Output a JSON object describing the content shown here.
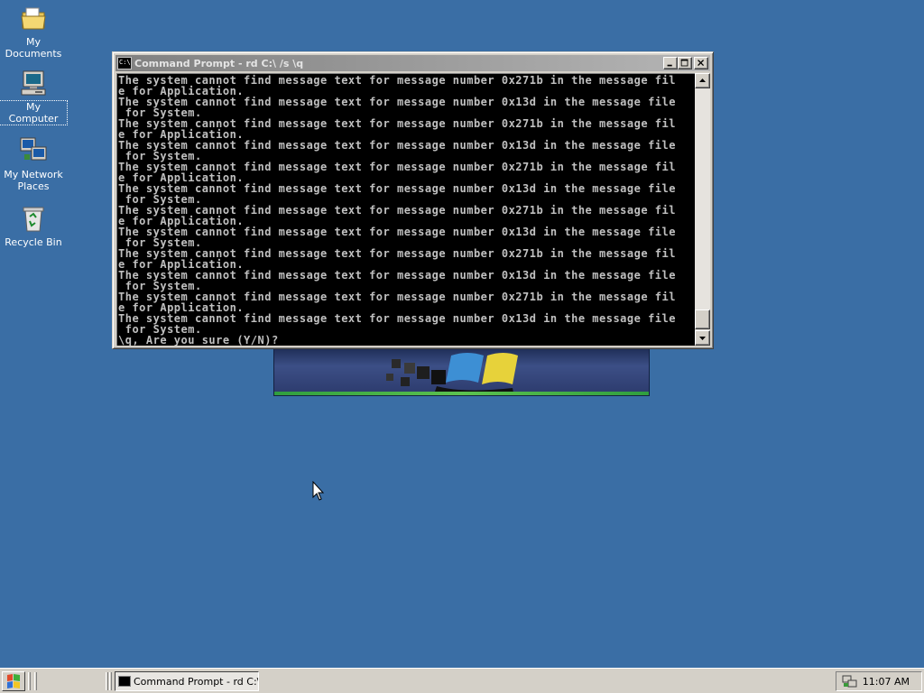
{
  "desktop": {
    "background": "#3a6ea5",
    "icons": [
      {
        "label": "My Documents",
        "icon": "folder-icon"
      },
      {
        "label": "My Computer",
        "icon": "computer-icon"
      },
      {
        "label": "My Network\nPlaces",
        "icon": "network-icon"
      },
      {
        "label": "Recycle Bin",
        "icon": "recycle-bin-icon"
      }
    ]
  },
  "window": {
    "title": "Command Prompt - rd C:\\ /s \\q",
    "sysicon_text": "C:\\",
    "console_lines": [
      "The system cannot find message text for message number 0x271b in the message fil",
      "e for Application.",
      " for System.",
      "The system cannot find message text for message number 0x271b in the message fil",
      "e for Application.",
      "The system cannot find message text for message number 0x13d in the message file",
      " for System.",
      "The system cannot find message text for message number 0x271b in the message fil",
      "e for Application.",
      "The system cannot find message text for message number 0x13d in the message file",
      " for System.",
      "The system cannot find message text for message number 0x271b in the message fil",
      "e for Application.",
      "The system cannot find message text for message number 0x13d in the message file",
      " for System.",
      "The system cannot find message text for message number 0x271b in the message fil",
      "e for Application.",
      "The system cannot find message text for message number 0x13d in the message file",
      " for System.",
      "The system cannot find message text for message number 0x271b in the message fil",
      "e for Application.",
      "The system cannot find message text for message number 0x13d in the message file",
      " for System.",
      "\\q, Are you sure (Y/N)?"
    ],
    "console_text": "The system cannot find message text for message number 0x271b in the message fil\ne for Application.\nThe system cannot find message text for message number 0x13d in the message file\n for System.\nThe system cannot find message text for message number 0x271b in the message fil\ne for Application.\nThe system cannot find message text for message number 0x13d in the message file\n for System.\nThe system cannot find message text for message number 0x271b in the message fil\ne for Application.\nThe system cannot find message text for message number 0x13d in the message file\n for System.\nThe system cannot find message text for message number 0x271b in the message fil\ne for Application.\nThe system cannot find message text for message number 0x13d in the message file\n for System.\nThe system cannot find message text for message number 0x271b in the message fil\ne for Application.\nThe system cannot find message text for message number 0x13d in the message file\n for System.\nThe system cannot find message text for message number 0x271b in the message fil\ne for Application.\nThe system cannot find message text for message number 0x13d in the message file\n for System.\n\\q, Are you sure (Y/N)?",
    "buttons": {
      "minimize": "minimize-icon",
      "maximize": "maximize-icon",
      "close": "close-icon"
    }
  },
  "taskbar": {
    "task_label": "Command Prompt - rd C:\\...",
    "clock": "11:07 AM"
  }
}
